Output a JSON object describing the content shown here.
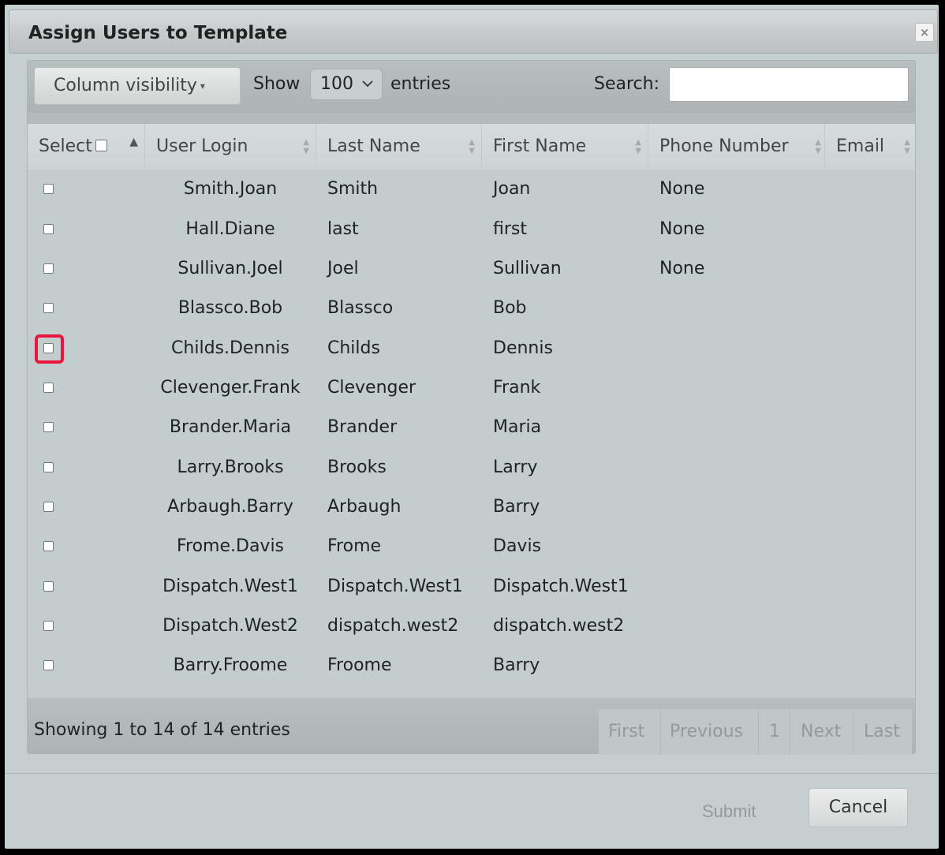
{
  "dialog": {
    "title": "Assign Users to Template",
    "close_glyph": "×"
  },
  "toolbar": {
    "column_visibility_label": "Column visibility",
    "show_label": "Show",
    "page_length": "100",
    "entries_label": "entries",
    "search_label": "Search:",
    "search_value": ""
  },
  "table": {
    "columns": [
      "Select",
      "User Login",
      "Last Name",
      "First Name",
      "Phone Number",
      "Email"
    ],
    "rows": [
      {
        "login": "Smith.Joan",
        "last": "Smith",
        "first": "Joan",
        "phone": "None",
        "email": ""
      },
      {
        "login": "Hall.Diane",
        "last": "last",
        "first": "first",
        "phone": "None",
        "email": ""
      },
      {
        "login": "Sullivan.Joel",
        "last": "Joel",
        "first": "Sullivan",
        "phone": "None",
        "email": ""
      },
      {
        "login": "Blassco.Bob",
        "last": "Blassco",
        "first": "Bob",
        "phone": "",
        "email": ""
      },
      {
        "login": "Childs.Dennis",
        "last": "Childs",
        "first": "Dennis",
        "phone": "",
        "email": ""
      },
      {
        "login": "Clevenger.Frank",
        "last": "Clevenger",
        "first": "Frank",
        "phone": "",
        "email": ""
      },
      {
        "login": "Brander.Maria",
        "last": "Brander",
        "first": "Maria",
        "phone": "",
        "email": ""
      },
      {
        "login": "Larry.Brooks",
        "last": "Brooks",
        "first": "Larry",
        "phone": "",
        "email": ""
      },
      {
        "login": "Arbaugh.Barry",
        "last": "Arbaugh",
        "first": "Barry",
        "phone": "",
        "email": ""
      },
      {
        "login": "Frome.Davis",
        "last": "Frome",
        "first": "Davis",
        "phone": "",
        "email": ""
      },
      {
        "login": "Dispatch.West1",
        "last": "Dispatch.West1",
        "first": "Dispatch.West1",
        "phone": "",
        "email": ""
      },
      {
        "login": "Dispatch.West2",
        "last": "dispatch.west2",
        "first": "dispatch.west2",
        "phone": "",
        "email": ""
      },
      {
        "login": "Barry.Froome",
        "last": "Froome",
        "first": "Barry",
        "phone": "",
        "email": ""
      }
    ]
  },
  "footer": {
    "info": "Showing 1 to 14 of 14 entries",
    "pagination": {
      "first": "First",
      "previous": "Previous",
      "current": "1",
      "next": "Next",
      "last": "Last"
    }
  },
  "actions": {
    "submit_label": "Submit",
    "cancel_label": "Cancel"
  },
  "highlight_color": "#e8153f"
}
